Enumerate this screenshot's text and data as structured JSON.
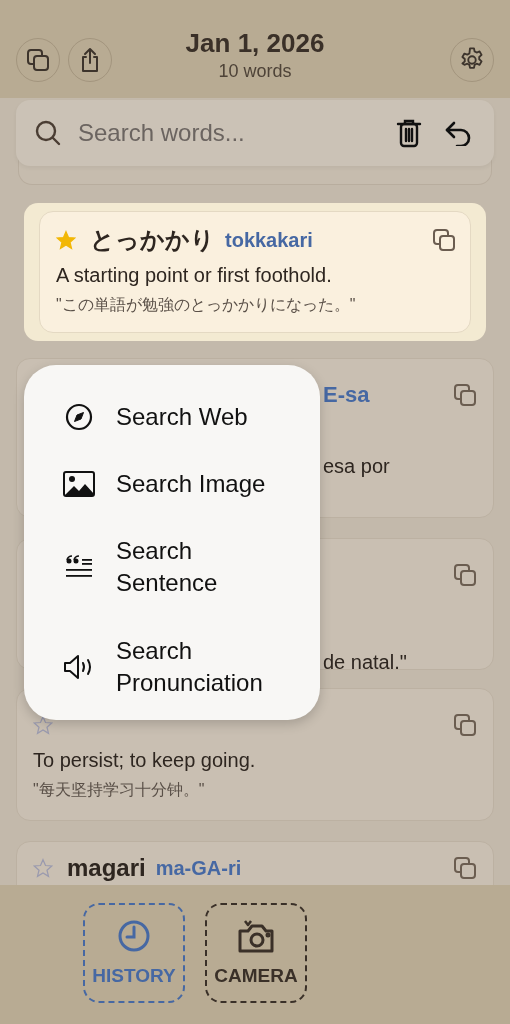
{
  "header": {
    "title": "Jan 1, 2026",
    "subtitle": "10 words"
  },
  "search": {
    "placeholder": "Search words..."
  },
  "focused_card": {
    "word": "とっかかり",
    "reading": "tokkakari",
    "starred": true,
    "definition": "A starting point or first foothold.",
    "example": "\"この単語が勉強のとっかかりになった。\""
  },
  "cards": [
    {
      "kind": "partial",
      "reading": "E-sa",
      "definition": "esa por"
    },
    {
      "kind": "partial",
      "example": "de natal.\""
    },
    {
      "kind": "full",
      "starred": false,
      "definition": "To persist; to keep going.",
      "example": "\"每天坚持学习十分钟。\""
    },
    {
      "kind": "full",
      "word": "magari",
      "reading": "ma-GA-ri",
      "starred": false
    }
  ],
  "menu": [
    {
      "kind": "compass",
      "label": "Search Web"
    },
    {
      "kind": "image",
      "label": "Search Image"
    },
    {
      "kind": "quote",
      "label": "Search Sentence"
    },
    {
      "kind": "speaker",
      "label": "Search Pronunciation"
    }
  ],
  "tabs": [
    {
      "kind": "history",
      "label": "HISTORY",
      "selected": true
    },
    {
      "kind": "camera",
      "label": "CAMERA",
      "selected": false
    }
  ]
}
